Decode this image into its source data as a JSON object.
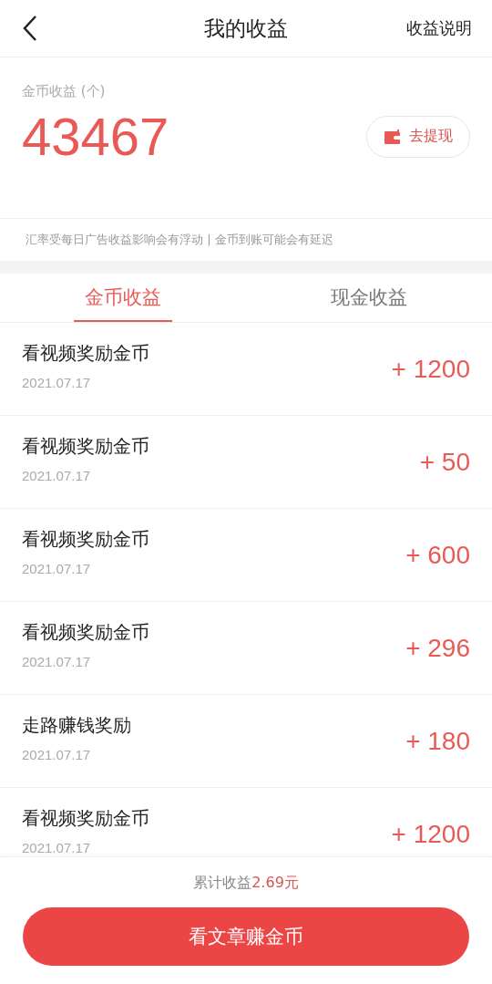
{
  "header": {
    "title": "我的收益",
    "action": "收益说明"
  },
  "summary": {
    "label": "金币收益 (个)",
    "amount": "43467",
    "withdraw_button": "去提现",
    "notice": "汇率受每日广告收益影响会有浮动 | 金币到账可能会有延迟"
  },
  "tabs": [
    {
      "label": "金币收益",
      "selected": true
    },
    {
      "label": "现金收益",
      "selected": false
    }
  ],
  "records": [
    {
      "title": "看视频奖励金币",
      "date": "2021.07.17",
      "amount": "+ 1200"
    },
    {
      "title": "看视频奖励金币",
      "date": "2021.07.17",
      "amount": "+ 50"
    },
    {
      "title": "看视频奖励金币",
      "date": "2021.07.17",
      "amount": "+ 600"
    },
    {
      "title": "看视频奖励金币",
      "date": "2021.07.17",
      "amount": "+ 296"
    },
    {
      "title": "走路赚钱奖励",
      "date": "2021.07.17",
      "amount": "+ 180"
    },
    {
      "title": "看视频奖励金币",
      "date": "2021.07.17",
      "amount": "+ 1200"
    }
  ],
  "footer": {
    "total_label": "累计收益",
    "total_value": "2.69元",
    "button": "看文章赚金币"
  }
}
